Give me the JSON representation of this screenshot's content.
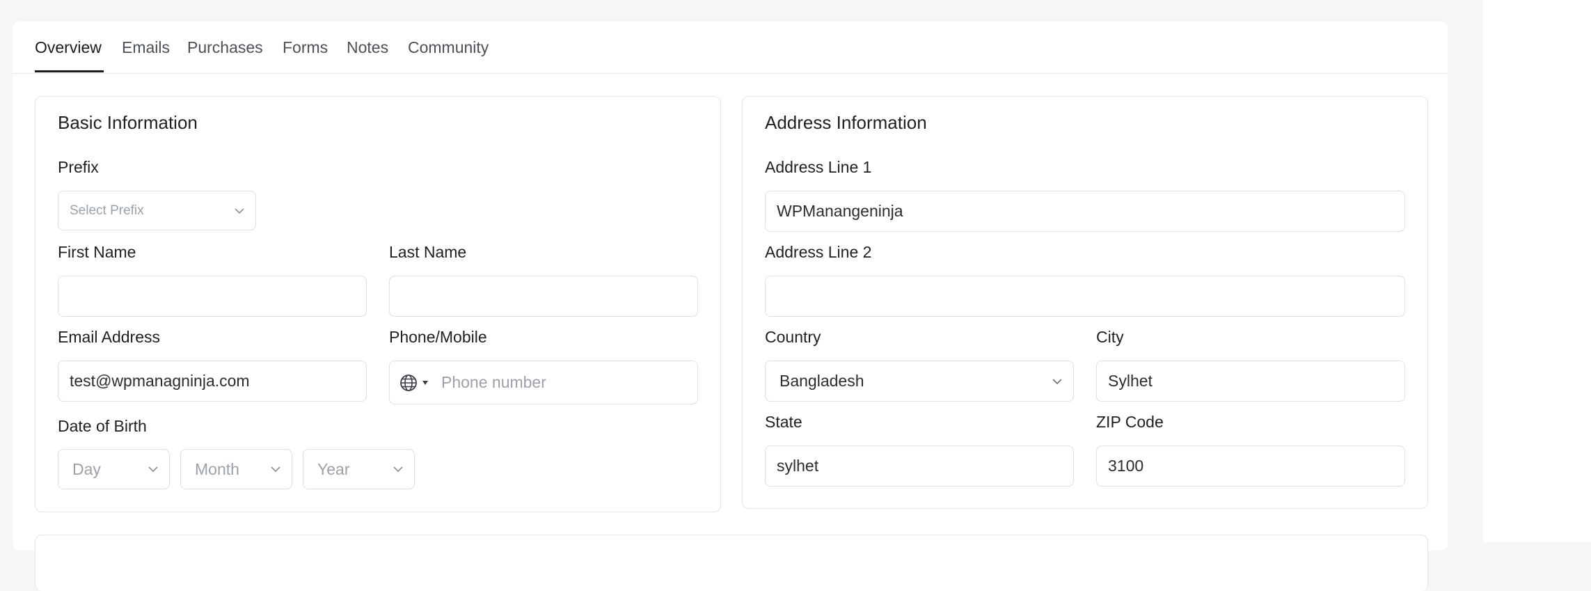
{
  "tabs": [
    {
      "label": "Overview",
      "active": true
    },
    {
      "label": "Emails"
    },
    {
      "label": "Purchases"
    },
    {
      "label": "Forms"
    },
    {
      "label": "Notes"
    },
    {
      "label": "Community"
    }
  ],
  "basic": {
    "title": "Basic Information",
    "prefix_label": "Prefix",
    "prefix_placeholder": "Select Prefix",
    "first_name_label": "First Name",
    "first_name_value": "",
    "last_name_label": "Last Name",
    "last_name_value": "",
    "email_label": "Email Address",
    "email_value": "test@wpmanagninja.com",
    "phone_label": "Phone/Mobile",
    "phone_placeholder": "Phone number",
    "dob_label": "Date of Birth",
    "day_placeholder": "Day",
    "month_placeholder": "Month",
    "year_placeholder": "Year"
  },
  "address": {
    "title": "Address Information",
    "line1_label": "Address Line 1",
    "line1_value": "WPManangeninja",
    "line2_label": "Address Line 2",
    "line2_value": "",
    "country_label": "Country",
    "country_value": "Bangladesh",
    "city_label": "City",
    "city_value": "Sylhet",
    "state_label": "State",
    "state_value": "sylhet",
    "zip_label": "ZIP Code",
    "zip_value": "3100"
  },
  "icons": {
    "chevron": "chevron-down-icon",
    "globe": "globe-icon",
    "caret": "caret-down-icon"
  },
  "colors": {
    "active_tab_underline": "#1a1b1e",
    "border": "#dcdfe4",
    "placeholder": "#9ca1a9"
  }
}
